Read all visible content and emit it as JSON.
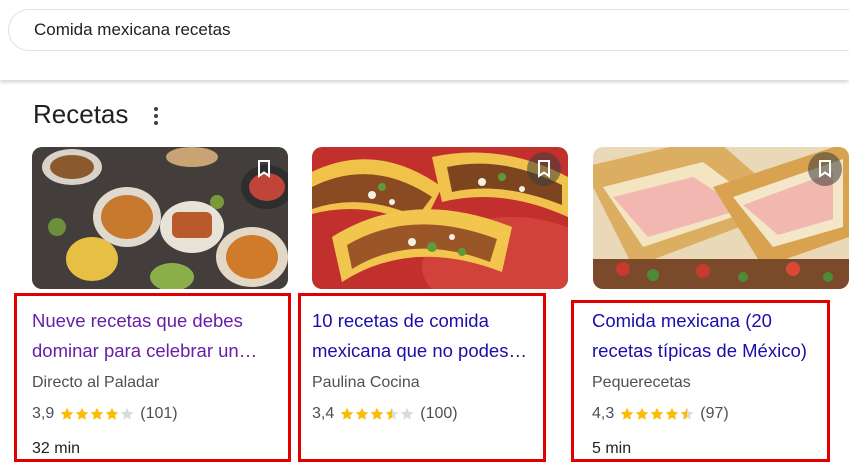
{
  "search": {
    "query": "Comida mexicana recetas"
  },
  "section": {
    "title": "Recetas"
  },
  "cards": [
    {
      "title_line1": "Nueve recetas que debes",
      "title_line2": "dominar para celebrar un…",
      "source": "Directo al Paladar",
      "rating": "3,9",
      "stars": 4,
      "reviews": "(101)",
      "time": "32 min"
    },
    {
      "title_line1": "10 recetas de comida",
      "title_line2": "mexicana que no podes…",
      "source": "Paulina Cocina",
      "rating": "3,4",
      "stars": 3.5,
      "reviews": "(100)",
      "time": ""
    },
    {
      "title_line1": "Comida mexicana (20",
      "title_line2": "recetas típicas de México)",
      "source": "Pequerecetas",
      "rating": "4,3",
      "stars": 4.5,
      "reviews": "(97)",
      "time": "5 min"
    }
  ],
  "colors": {
    "link": "#1a0dab",
    "visited": "#681da8",
    "star": "#fbbc04",
    "highlight": "#e00000"
  }
}
